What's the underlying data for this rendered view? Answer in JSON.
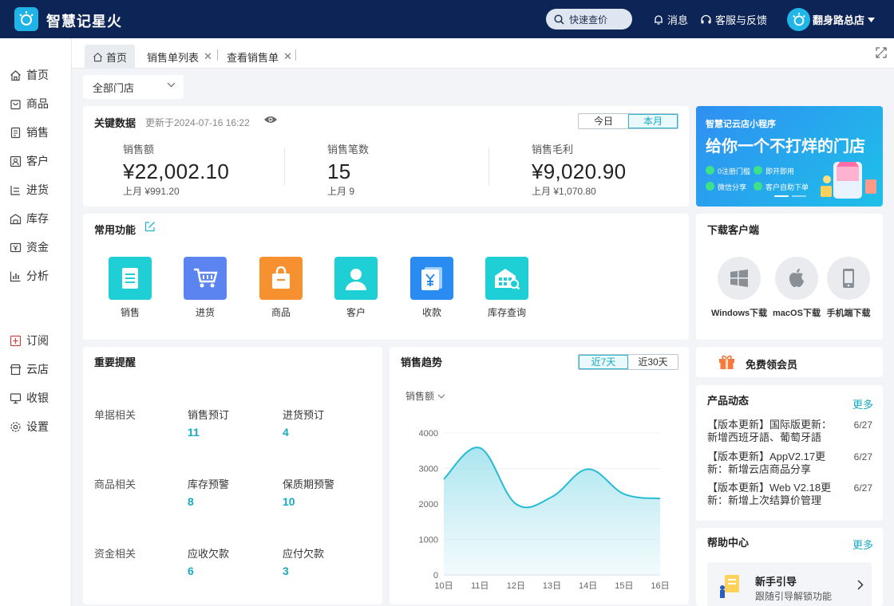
{
  "header": {
    "app_title": "智慧记星火",
    "search_placeholder": "快速查价",
    "messages": "消息",
    "support": "客服与反馈",
    "store_name": "翻身路总店"
  },
  "sidebar": {
    "primary": [
      "首页",
      "商品",
      "销售",
      "客户",
      "进货",
      "库存",
      "资金",
      "分析"
    ],
    "secondary": [
      "订阅",
      "云店",
      "收银",
      "设置"
    ]
  },
  "tabs": [
    {
      "label": "首页",
      "closable": false,
      "active": true
    },
    {
      "label": "销售单列表",
      "closable": true,
      "active": false
    },
    {
      "label": "查看销售单",
      "closable": true,
      "active": false
    }
  ],
  "store_filter": "全部门店",
  "key_data": {
    "title": "关键数据",
    "updated": "更新于2024-07-16 16:22",
    "periods": [
      "今日",
      "本月"
    ],
    "active_period": "本月",
    "metrics": [
      {
        "label": "销售额",
        "value": "¥22,002.10",
        "previous": "上月 ¥991.20"
      },
      {
        "label": "销售笔数",
        "value": "15",
        "previous": "上月 9"
      },
      {
        "label": "销售毛利",
        "value": "¥9,020.90",
        "previous": "上月 ¥1,070.80"
      }
    ]
  },
  "banner": {
    "subtitle": "智慧记云店小程序",
    "title": "给你一个不打烊的门店",
    "features": [
      "0注册门槛",
      "即开即用",
      "微信分享",
      "客户自助下单"
    ]
  },
  "common_functions": {
    "title": "常用功能",
    "items": [
      {
        "label": "销售",
        "color": "#1ecfd6"
      },
      {
        "label": "进货",
        "color": "#5b84f0"
      },
      {
        "label": "商品",
        "color": "#f7902f"
      },
      {
        "label": "客户",
        "color": "#1ecfd6"
      },
      {
        "label": "收款",
        "color": "#2a8cf0"
      },
      {
        "label": "库存查询",
        "color": "#1ecfd6"
      }
    ]
  },
  "download": {
    "title": "下载客户端",
    "items": [
      "Windows下载",
      "macOS下载",
      "手机端下载"
    ]
  },
  "reminders": {
    "title": "重要提醒",
    "groups": [
      {
        "category": "单据相关",
        "items": [
          {
            "label": "销售预订",
            "count": "11"
          },
          {
            "label": "进货预订",
            "count": "4"
          }
        ]
      },
      {
        "category": "商品相关",
        "items": [
          {
            "label": "库存预警",
            "count": "8"
          },
          {
            "label": "保质期预警",
            "count": "10"
          }
        ]
      },
      {
        "category": "资金相关",
        "items": [
          {
            "label": "应收欠款",
            "count": "6"
          },
          {
            "label": "应付欠款",
            "count": "3"
          }
        ]
      }
    ]
  },
  "sales_trend": {
    "title": "销售趋势",
    "ranges": [
      "近7天",
      "近30天"
    ],
    "active_range": "近7天",
    "metric_select": "销售额"
  },
  "chart_data": {
    "type": "area",
    "categories": [
      "10日",
      "11日",
      "12日",
      "13日",
      "14日",
      "15日",
      "16日"
    ],
    "values": [
      2700,
      3580,
      2000,
      2200,
      2980,
      2280,
      2150
    ],
    "ylim": [
      0,
      4000
    ],
    "yticks": [
      "0",
      "1000",
      "2000",
      "3000",
      "4000"
    ],
    "color": "#27bcd3"
  },
  "membership": {
    "label": "免费领会员"
  },
  "product_news": {
    "title": "产品动态",
    "more": "更多",
    "items": [
      {
        "text": "【版本更新】国际版更新：新增西班牙語、葡萄牙語",
        "date": "6/27"
      },
      {
        "text": "【版本更新】AppV2.17更新：新增云店商品分享",
        "date": "6/27"
      },
      {
        "text": "【版本更新】Web V2.18更新：新增上次结算价管理",
        "date": "6/27"
      }
    ]
  },
  "help_center": {
    "title": "帮助中心",
    "more": "更多",
    "guide_title": "新手引导",
    "guide_sub": "跟随引导解锁功能"
  }
}
